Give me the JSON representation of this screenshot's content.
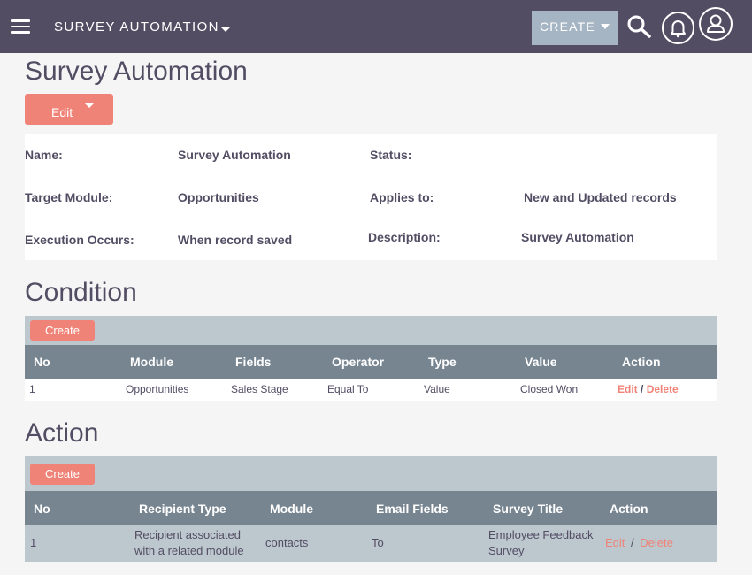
{
  "header": {
    "module_title": "SURVEY AUTOMATION",
    "create_label": "CREATE",
    "icons": [
      "menu-icon",
      "search-icon",
      "notification-bell-icon",
      "user-profile-icon"
    ]
  },
  "page": {
    "title": "Survey Automation",
    "edit_label": "Edit"
  },
  "details": {
    "name_label": "Name:",
    "name_value": "Survey Automation",
    "status_label": "Status:",
    "status_value": "",
    "target_module_label": "Target Module:",
    "target_module_value": "Opportunities",
    "applies_to_label": "Applies to:",
    "applies_to_value": "New and Updated records",
    "execution_label": "Execution Occurs:",
    "execution_value": "When record saved",
    "description_label": "Description:",
    "description_value": "Survey Automation"
  },
  "condition": {
    "title": "Condition",
    "create_label": "Create",
    "columns": [
      "No",
      "Module",
      "Fields",
      "Operator",
      "Type",
      "Value",
      "Action"
    ],
    "rows": [
      {
        "no": "1",
        "module": "Opportunities",
        "fields": "Sales Stage",
        "operator": "Equal To",
        "type": "Value",
        "value": "Closed Won",
        "edit": "Edit",
        "separator": "/",
        "delete": "Delete"
      }
    ]
  },
  "action": {
    "title": "Action",
    "create_label": "Create",
    "columns": [
      "No",
      "Recipient Type",
      "Module",
      "Email Fields",
      "Survey Title",
      "Action"
    ],
    "rows": [
      {
        "no": "1",
        "recipient_type_line1": "Recipient associated",
        "recipient_type_line2": "with a related module",
        "module": "contacts",
        "email_fields": "To",
        "survey_title_line1": "Employee Feedback",
        "survey_title_line2": "Survey",
        "edit": "Edit",
        "separator": "/",
        "delete": "Delete"
      }
    ]
  },
  "colors": {
    "nav": "#534d64",
    "accent": "#f08377",
    "toolbar": "#bcc7ce",
    "table_header": "#778591",
    "create_button": "#a5b5c4"
  }
}
